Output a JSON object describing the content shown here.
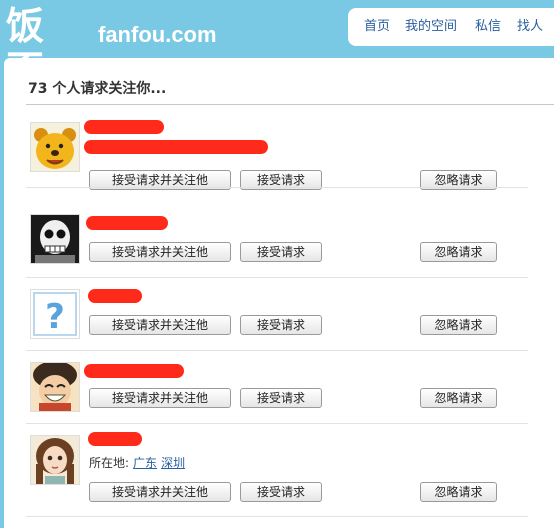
{
  "header": {
    "logo_cn": "饭否",
    "logo_en": "fanfou.com",
    "nav": [
      "首页",
      "我的空间",
      "私信",
      "找人"
    ]
  },
  "page": {
    "title": "73 个人请求关注你..."
  },
  "requests": [
    {
      "avatar": "winnie-the-pooh-avatar"
    },
    {
      "avatar": "skull-face-avatar"
    },
    {
      "avatar": "question-mark-avatar"
    },
    {
      "avatar": "cartoon-boy-avatar"
    },
    {
      "avatar": "cartoon-girl-avatar",
      "location_label": "所在地:",
      "province": "广东",
      "city": "深圳"
    }
  ],
  "buttons": {
    "accept_follow": "接受请求并关注他",
    "accept": "接受请求",
    "ignore": "忽略请求"
  },
  "colors": {
    "background": "#7ac9e4",
    "link": "#2a5f9e",
    "redaction": "#ff2a1a"
  }
}
